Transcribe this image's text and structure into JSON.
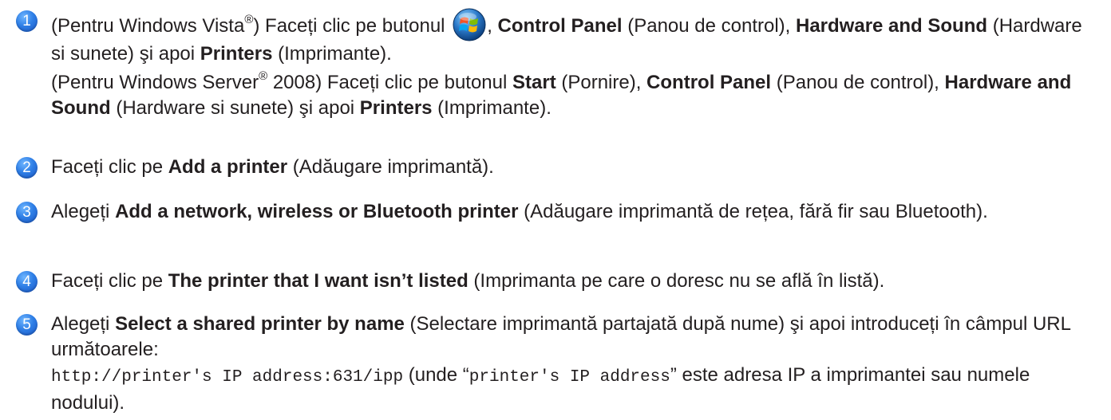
{
  "steps": [
    {
      "number": "1",
      "paragraphs": [
        {
          "a": "(Pentru Windows Vista",
          "reg": "®",
          "b": ") Faceți clic pe butonul ",
          "c": ", ",
          "d": "Control Panel",
          "e": " (Panou de control), ",
          "f": "Hardware and Sound",
          "g": " (Hardware si sunete) şi apoi ",
          "h": "Printers",
          "i": " (Imprimante)."
        },
        {
          "a": "(Pentru Windows Server",
          "reg": "®",
          "b": " 2008) Faceți clic pe butonul ",
          "c": "Start",
          "d": " (Pornire), ",
          "e": "Control Panel",
          "f": " (Panou de control), ",
          "g": "Hardware and Sound",
          "h": " (Hardware si sunete) şi apoi ",
          "i": "Printers",
          "j": " (Imprimante)."
        }
      ]
    },
    {
      "number": "2",
      "a": "Faceți clic pe ",
      "b": "Add a printer",
      "c": " (Adăugare imprimantă)."
    },
    {
      "number": "3",
      "a": "Alegeți ",
      "b": "Add a network, wireless or Bluetooth printer",
      "c": " (Adăugare imprimantă de rețea, fără fir sau Bluetooth)."
    },
    {
      "number": "4",
      "a": "Faceți clic pe ",
      "b": "The printer that I want isn’t listed",
      "c": " (Imprimanta pe care o doresc nu se află în listă)."
    },
    {
      "number": "5",
      "a": "Alegeți ",
      "b": "Select a shared printer by name",
      "c": " (Selectare imprimantă partajată după nume) şi apoi introduceți în câmpul URL următoarele:",
      "code1": "http://printer's IP address:631/ipp",
      "d": " (unde “",
      "code2": "printer's IP address",
      "e": "” este adresa IP a imprimantei sau numele nodului)."
    }
  ],
  "icons": {
    "start_button": "windows-vista-start-orb-icon"
  }
}
